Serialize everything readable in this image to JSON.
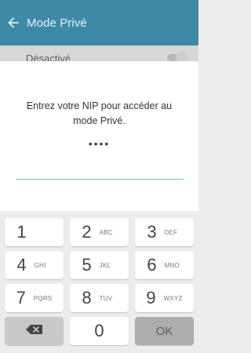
{
  "appbar": {
    "title": "Mode Privé",
    "back_icon": "arrow-back-icon",
    "color": "#3d8aa8"
  },
  "behind": {
    "status_label": "Désactivé"
  },
  "dialog": {
    "prompt": "Entrez votre NIP pour accéder au mode Privé.",
    "pin_masked": "••••"
  },
  "keypad": {
    "keys": [
      {
        "digit": "1",
        "letters": ""
      },
      {
        "digit": "2",
        "letters": "ABC"
      },
      {
        "digit": "3",
        "letters": "DEF"
      },
      {
        "digit": "4",
        "letters": "GHI"
      },
      {
        "digit": "5",
        "letters": "JKL"
      },
      {
        "digit": "6",
        "letters": "MNO"
      },
      {
        "digit": "7",
        "letters": "PQRS"
      },
      {
        "digit": "8",
        "letters": "TUV"
      },
      {
        "digit": "9",
        "letters": "WXYZ"
      }
    ],
    "zero": "0",
    "backspace_icon": "backspace-icon",
    "ok_label": "OK"
  }
}
